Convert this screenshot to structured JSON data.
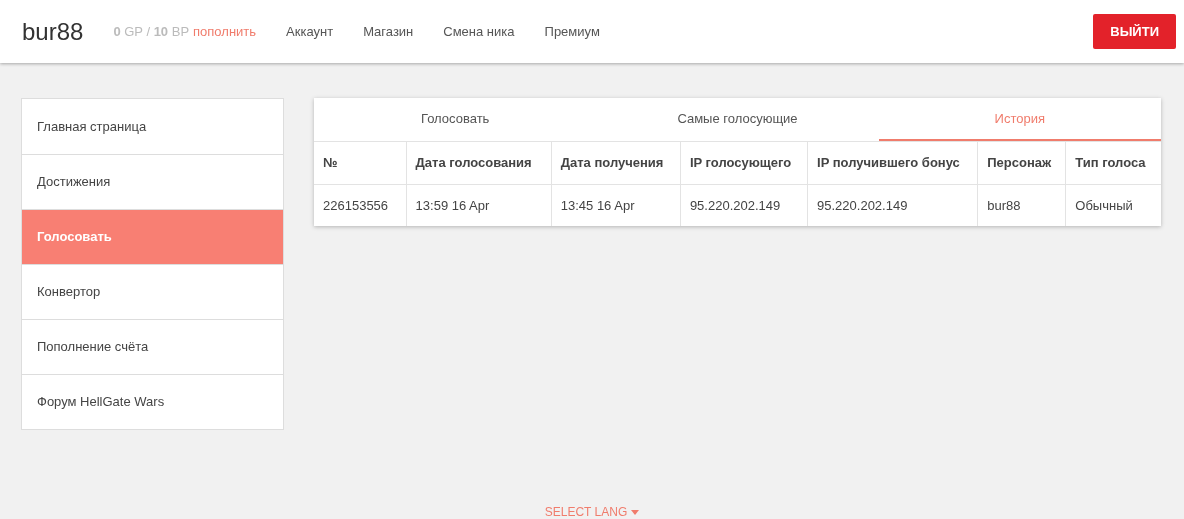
{
  "header": {
    "username": "bur88",
    "balance": "**0** GP / **10** BP",
    "topup_link": "пополнить",
    "nav": [
      "Аккаунт",
      "Магазин",
      "Смена ника",
      "Премиум"
    ],
    "logout": "ВЫЙТИ"
  },
  "sidebar": {
    "items": [
      {
        "label": "Главная страница",
        "selected": false
      },
      {
        "label": "Достижения",
        "selected": false
      },
      {
        "label": "Голосовать",
        "selected": true
      },
      {
        "label": "Конвертор",
        "selected": false
      },
      {
        "label": "Пополнение счёта",
        "selected": false
      },
      {
        "label": "Форум HellGate Wars",
        "selected": false
      }
    ]
  },
  "tabs": [
    {
      "label": "Голосовать",
      "selected": false
    },
    {
      "label": "Самые голосующие",
      "selected": false
    },
    {
      "label": "История",
      "selected": true
    }
  ],
  "table": {
    "columns": [
      "№",
      "Дата голосования",
      "Дата получения",
      "IP голосующего",
      "IP получившего бонус",
      "Персонаж",
      "Тип голоса"
    ],
    "rows": [
      [
        "226153556",
        "13:59 16 Apr",
        "13:45 16 Apr",
        "95.220.202.149",
        "95.220.202.149",
        "bur88",
        "Обычный"
      ]
    ]
  },
  "footer": {
    "lang_button": "SELECT LANG"
  }
}
